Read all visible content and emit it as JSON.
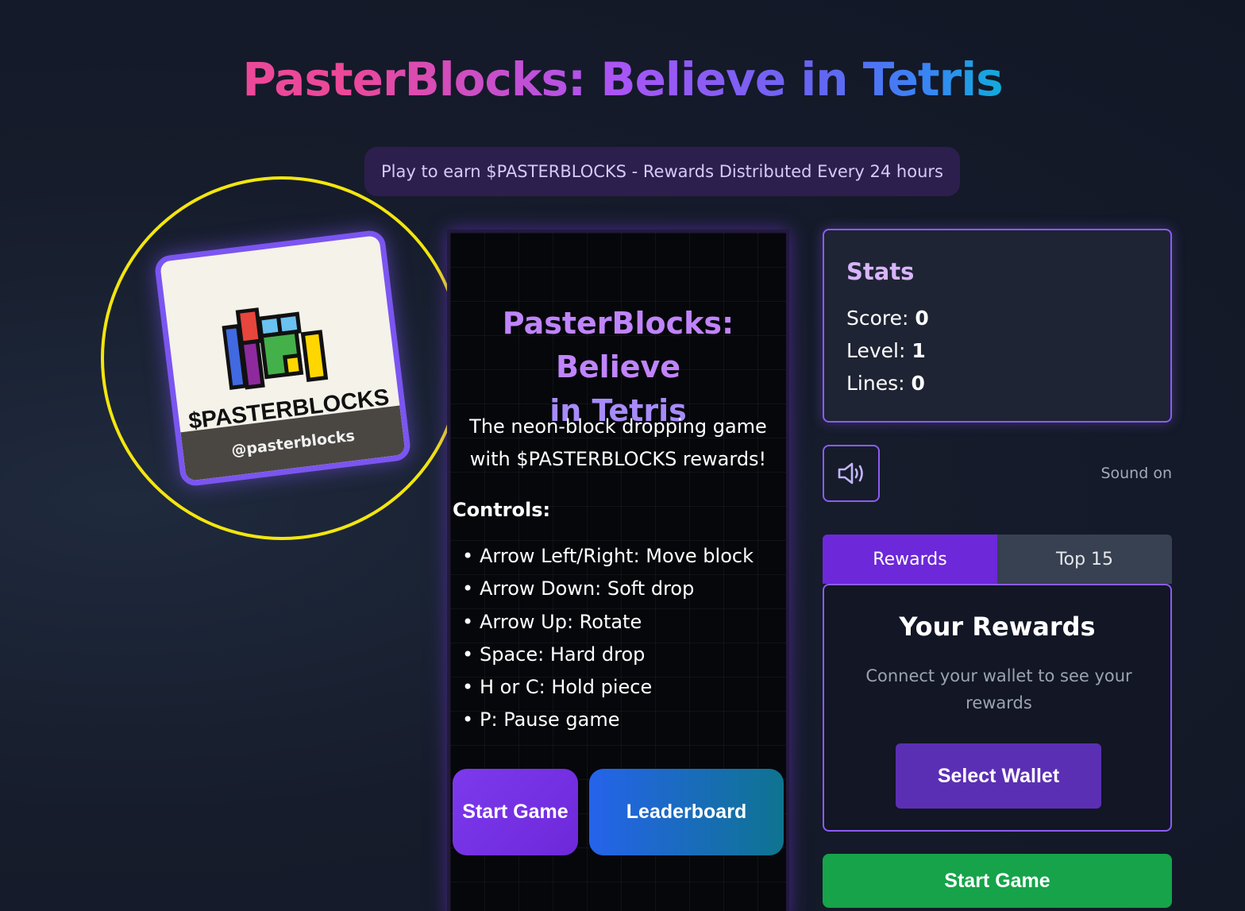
{
  "header": {
    "title": "PasterBlocks: Believe in Tetris",
    "banner": "Play to earn $PASTERBLOCKS - Rewards Distributed Every 24 hours"
  },
  "logo": {
    "name": "$PASTERBLOCKS",
    "handle": "@pasterblocks"
  },
  "board": {
    "title_line1": "PasterBlocks: Believe",
    "title_line2": "in Tetris",
    "description": "The neon-block dropping game with $PASTERBLOCKS rewards!",
    "controls_heading": "Controls:",
    "controls": [
      "Arrow Left/Right: Move block",
      "Arrow Down: Soft drop",
      "Arrow Up: Rotate",
      "Space: Hard drop",
      "H or C: Hold piece",
      "P: Pause game"
    ],
    "start_label": "Start Game",
    "leaderboard_label": "Leaderboard"
  },
  "stats": {
    "heading": "Stats",
    "score_label": "Score:",
    "score": "0",
    "level_label": "Level:",
    "level": "1",
    "lines_label": "Lines:",
    "lines": "0"
  },
  "sound": {
    "icon": "speaker-icon",
    "label": "Sound on"
  },
  "tabs": {
    "rewards": "Rewards",
    "top": "Top 15"
  },
  "rewards": {
    "heading": "Your Rewards",
    "text": "Connect your wallet to see your rewards",
    "wallet_button": "Select Wallet"
  },
  "sidebar": {
    "start_label": "Start Game"
  },
  "colors": {
    "accent": "#8b5cf6",
    "tab_active": "#6d28d9",
    "start_green": "#16a34a",
    "highlight_ring": "#f3e60f"
  }
}
